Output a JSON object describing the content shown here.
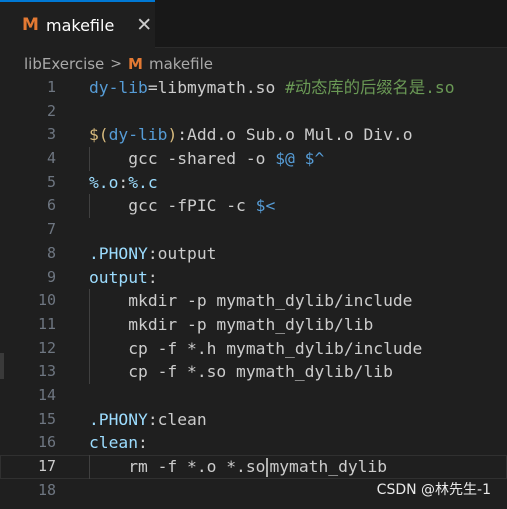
{
  "tab": {
    "icon_letter": "M",
    "title": "makefile",
    "close_glyph": "✕"
  },
  "breadcrumb": {
    "folder": "libExercise",
    "separator": ">",
    "icon_letter": "M",
    "file": "makefile"
  },
  "editor": {
    "active_line": 17,
    "lines": [
      {
        "n": "1",
        "tokens": [
          [
            "var",
            "dy-lib"
          ],
          [
            "plain",
            "=libmymath.so "
          ],
          [
            "comment",
            "#动态库的后缀名是.so"
          ]
        ]
      },
      {
        "n": "2",
        "tokens": []
      },
      {
        "n": "3",
        "tokens": [
          [
            "fn",
            "$("
          ],
          [
            "var",
            "dy-lib"
          ],
          [
            "fn",
            ")"
          ],
          [
            "plain",
            ":Add.o Sub.o Mul.o Div.o"
          ]
        ]
      },
      {
        "n": "4",
        "tokens": [
          [
            "plain",
            "    gcc -shared -o "
          ],
          [
            "auto",
            "$@ $^"
          ]
        ]
      },
      {
        "n": "5",
        "tokens": [
          [
            "target",
            "%.o"
          ],
          [
            "plain",
            ":"
          ],
          [
            "target",
            "%.c"
          ]
        ]
      },
      {
        "n": "6",
        "tokens": [
          [
            "plain",
            "    gcc -fPIC -c "
          ],
          [
            "auto",
            "$<"
          ]
        ]
      },
      {
        "n": "7",
        "tokens": []
      },
      {
        "n": "8",
        "tokens": [
          [
            "target",
            ".PHONY"
          ],
          [
            "plain",
            ":output"
          ]
        ]
      },
      {
        "n": "9",
        "tokens": [
          [
            "target",
            "output"
          ],
          [
            "plain",
            ":"
          ]
        ]
      },
      {
        "n": "10",
        "tokens": [
          [
            "plain",
            "    mkdir -p mymath_dylib/include"
          ]
        ]
      },
      {
        "n": "11",
        "tokens": [
          [
            "plain",
            "    mkdir -p mymath_dylib/lib"
          ]
        ]
      },
      {
        "n": "12",
        "tokens": [
          [
            "plain",
            "    cp -f *.h mymath_dylib/include"
          ]
        ]
      },
      {
        "n": "13",
        "tokens": [
          [
            "plain",
            "    cp -f *.so mymath_dylib/lib"
          ]
        ]
      },
      {
        "n": "14",
        "tokens": []
      },
      {
        "n": "15",
        "tokens": [
          [
            "target",
            ".PHONY"
          ],
          [
            "plain",
            ":clean"
          ]
        ]
      },
      {
        "n": "16",
        "tokens": [
          [
            "target",
            "clean"
          ],
          [
            "plain",
            ":"
          ]
        ]
      },
      {
        "n": "17",
        "tokens": [
          [
            "plain",
            "    rm -f *.o *.so"
          ],
          [
            "cursor",
            ""
          ],
          [
            "plain",
            "mymath_dylib"
          ]
        ]
      },
      {
        "n": "18",
        "tokens": []
      }
    ]
  },
  "watermark": "CSDN @林先生-1",
  "colors": {
    "accent": "#0078d4",
    "makefile_icon": "#e37933",
    "variable": "#569cd6",
    "comment": "#6a9955"
  }
}
